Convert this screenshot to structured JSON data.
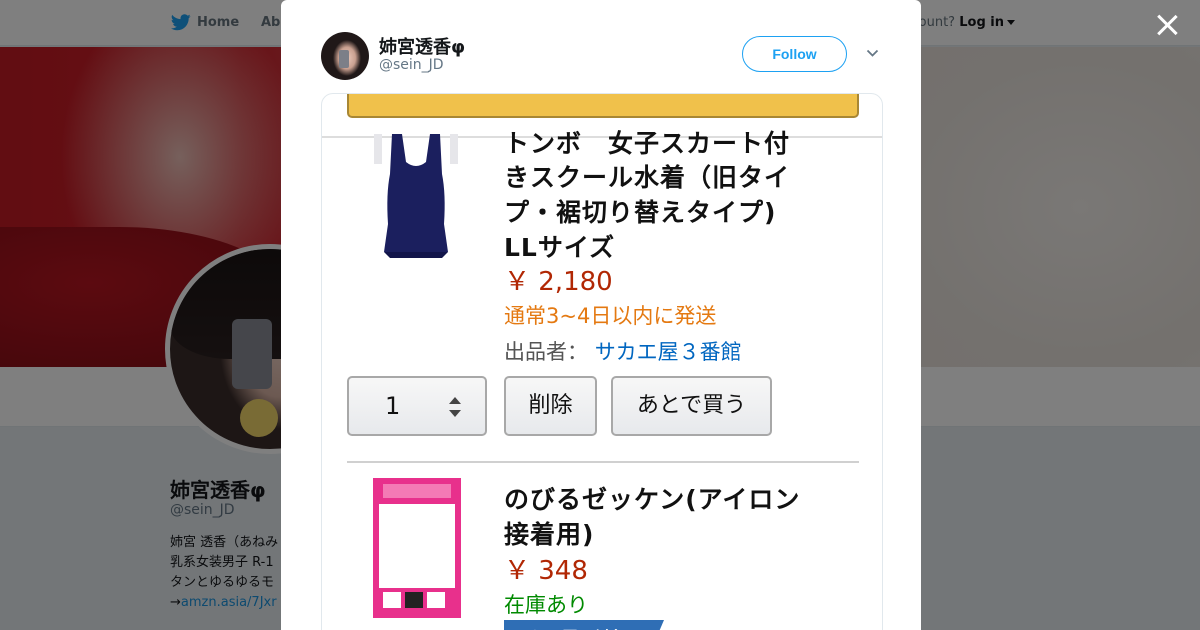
{
  "topnav": {
    "home_label": "Home",
    "about_label": "Abo",
    "account_prompt": "ccount?",
    "login_label": "Log in"
  },
  "background_profile": {
    "name": "姉宮透香φ",
    "handle": "@sein_JD",
    "bio_lines": [
      "姉宮 透香（あねみ",
      "乳系女装男子 R-1",
      "タンとゆるゆるモ"
    ],
    "bio_link_prefix": "→",
    "bio_link": "amzn.asia/7Jxr"
  },
  "modal": {
    "author_name": "姉宮透香φ",
    "author_handle": "@sein_JD",
    "follow_label": "Follow",
    "icons": {
      "close": "close-icon",
      "more": "chevron-down-icon",
      "home": "twitter-bird-icon"
    }
  },
  "tweet_image": {
    "item1": {
      "title_lines": [
        "トンボ　女子スカート付",
        "きスクール水着（旧タイ",
        "プ・裾切り替えタイプ)",
        "LLサイズ"
      ],
      "price": "￥ 2,180",
      "shipping": "通常3~4日以内に発送",
      "seller_label": "出品者：",
      "seller_name": "サカエ屋３番館",
      "quantity": "1",
      "delete_label": "削除",
      "save_later_label": "あとで買う"
    },
    "item2": {
      "title_lines": [
        "のびるゼッケン(アイロン",
        "接着用)"
      ],
      "price": "￥ 348",
      "stock": "在庫あり",
      "badge": "あわせ買い対象"
    },
    "colors": {
      "price": "#b12704",
      "shipping": "#e47911",
      "seller_link": "#0066c0",
      "stock": "#008a00",
      "checkout_button": "#f0c14b"
    }
  }
}
